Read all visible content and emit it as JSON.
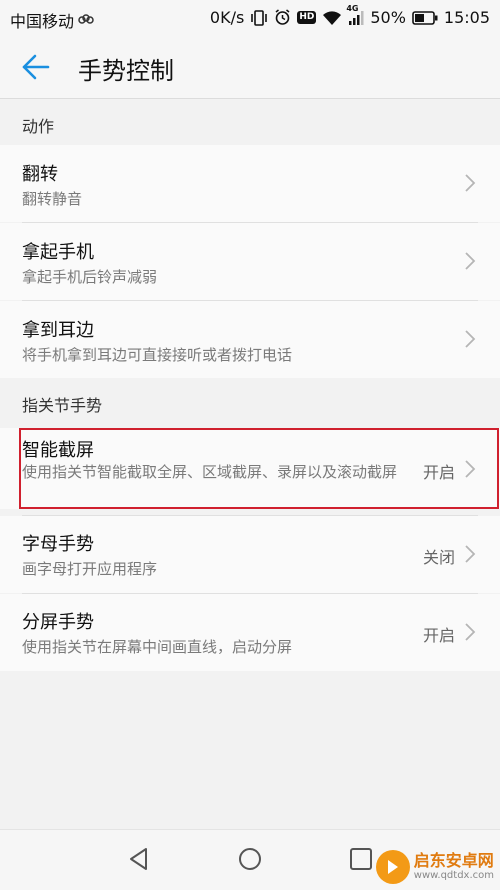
{
  "status_bar": {
    "carrier": "中国移动",
    "speed": "0K/s",
    "network": "4G",
    "battery": "50%",
    "time": "15:05",
    "hd": "HD"
  },
  "header": {
    "title": "手势控制"
  },
  "sections": [
    {
      "title": "动作",
      "items": [
        {
          "title": "翻转",
          "subtitle": "翻转静音",
          "value": ""
        },
        {
          "title": "拿起手机",
          "subtitle": "拿起手机后铃声减弱",
          "value": ""
        },
        {
          "title": "拿到耳边",
          "subtitle": "将手机拿到耳边可直接接听或者拨打电话",
          "value": ""
        }
      ]
    },
    {
      "title": "指关节手势",
      "items": [
        {
          "title": "智能截屏",
          "subtitle": "使用指关节智能截取全屏、区域截屏、录屏以及滚动截屏",
          "value": "开启"
        },
        {
          "title": "字母手势",
          "subtitle": "画字母打开应用程序",
          "value": "关闭"
        },
        {
          "title": "分屏手势",
          "subtitle": "使用指关节在屏幕中间画直线，启动分屏",
          "value": "开启"
        }
      ]
    }
  ],
  "watermark": {
    "name": "启东安卓网",
    "url": "www.qdtdx.com"
  },
  "colors": {
    "accent": "#1a8fe0",
    "highlight_border": "#d0202e",
    "background": "#f2f2f2"
  },
  "icons": {
    "back": "arrow-left-icon",
    "chevron": "chevron-right-icon",
    "nav_back": "triangle-back-icon",
    "nav_home": "circle-home-icon",
    "nav_recent": "square-recent-icon"
  }
}
